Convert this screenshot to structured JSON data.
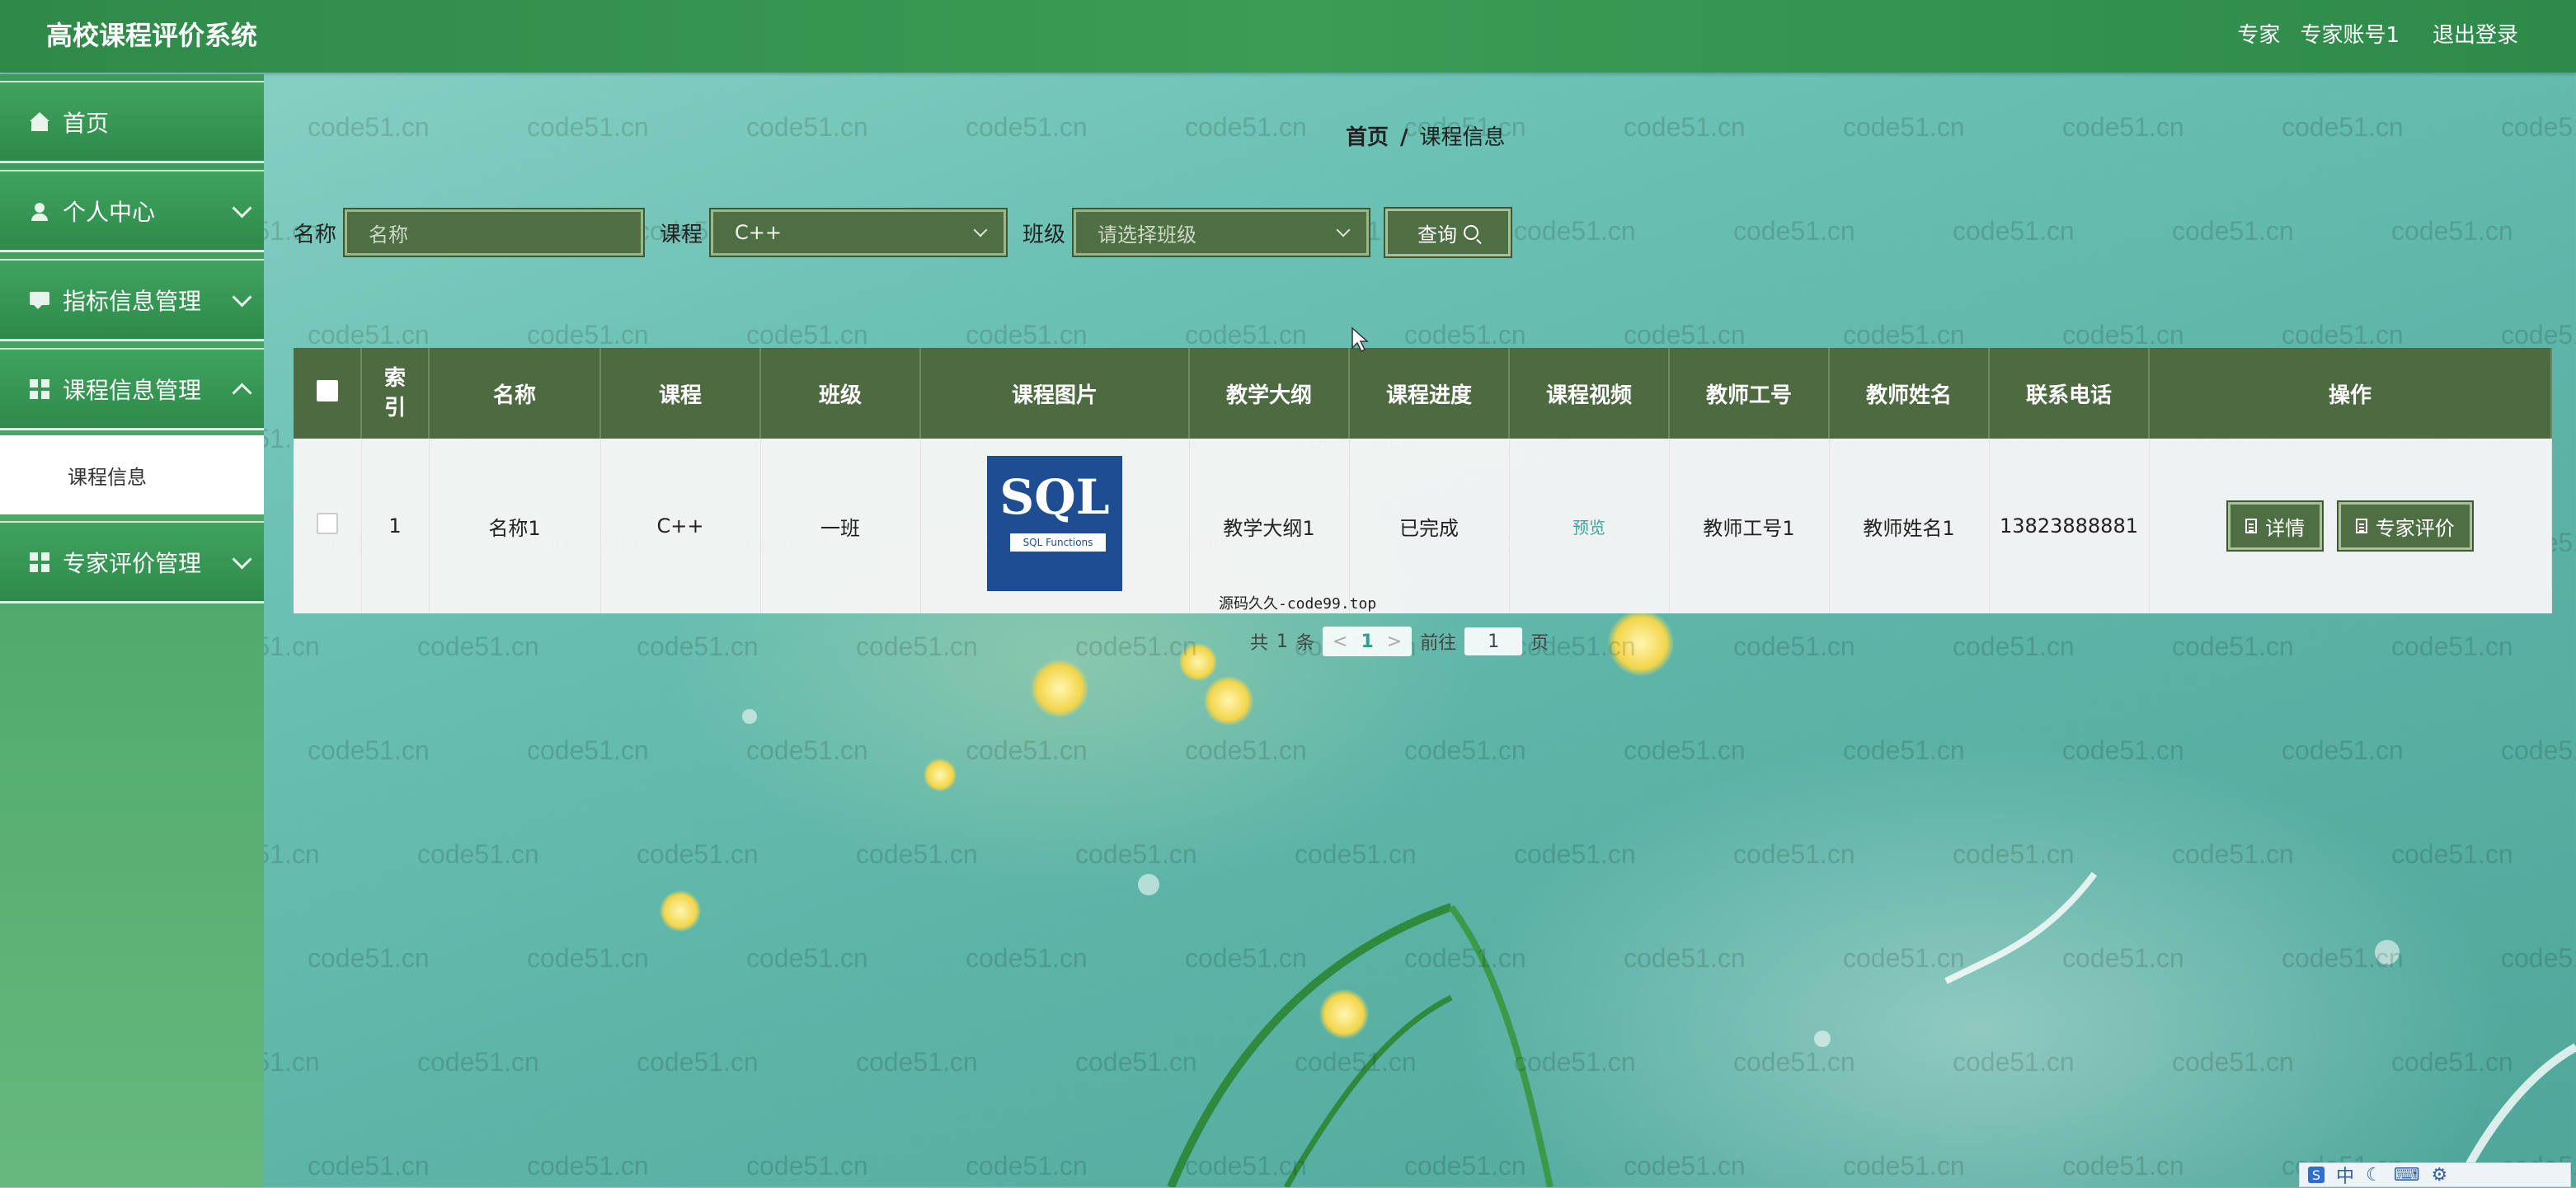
{
  "app": {
    "title": "高校课程评价系统"
  },
  "topbar": {
    "role": "专家",
    "account": "专家账号1",
    "logout": "退出登录"
  },
  "sidebar": {
    "items": [
      {
        "label": "首页"
      },
      {
        "label": "个人中心"
      },
      {
        "label": "指标信息管理"
      },
      {
        "label": "课程信息管理"
      },
      {
        "label": "课程信息"
      },
      {
        "label": "专家评价管理"
      }
    ]
  },
  "breadcrumb": {
    "home": "首页",
    "separator": "/",
    "current": "课程信息"
  },
  "search": {
    "name_label": "名称",
    "name_placeholder": "名称",
    "course_label": "课程",
    "course_value": "C++",
    "class_label": "班级",
    "class_placeholder": "请选择班级",
    "query_label": "查询"
  },
  "table": {
    "columns": [
      "索引",
      "名称",
      "课程",
      "班级",
      "课程图片",
      "教学大纲",
      "课程进度",
      "课程视频",
      "教师工号",
      "教师姓名",
      "联系电话",
      "操作"
    ],
    "rows": [
      {
        "index": "1",
        "name": "名称1",
        "course": "C++",
        "class": "一班",
        "image_title": "SQL",
        "image_subtitle": "SQL Functions",
        "syllabus": "教学大纲1",
        "progress": "已完成",
        "video": "预览",
        "teacher_id": "教师工号1",
        "teacher_name": "教师姓名1",
        "phone": "13823888881",
        "detail_label": "详情",
        "evaluate_label": "专家评价"
      }
    ]
  },
  "note": "源码久久-code99.top",
  "pagination": {
    "total_prefix": "共",
    "total": "1",
    "total_suffix": "条",
    "page": "1",
    "goto_prefix": "前往",
    "goto_value": "1",
    "goto_suffix": "页"
  },
  "watermark": "code51.cn",
  "ime": {
    "mode": "中"
  }
}
